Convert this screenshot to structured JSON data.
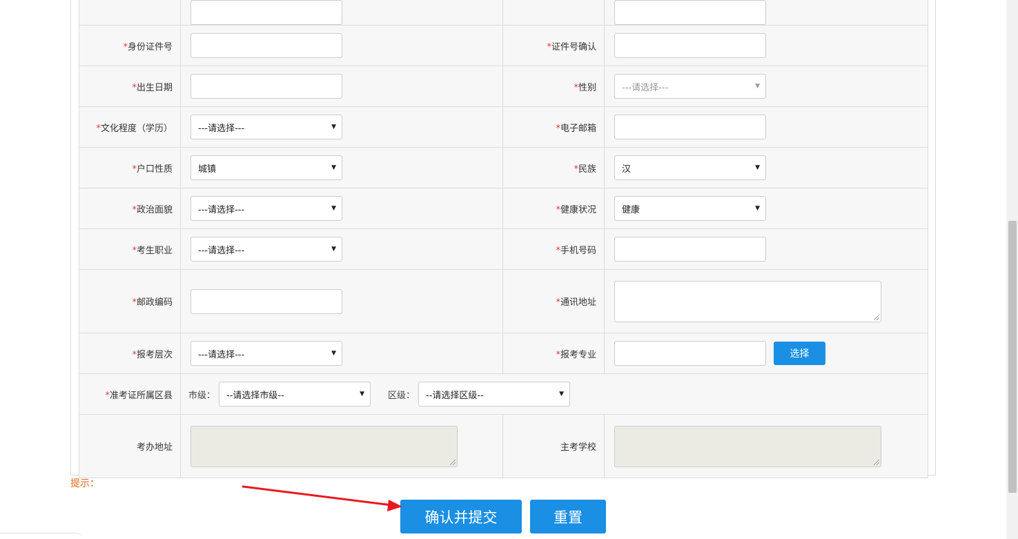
{
  "form": {
    "rows": [
      {
        "left": {
          "label": "身份证件号",
          "required": true,
          "type": "input",
          "value": ""
        },
        "right": {
          "label": "证件号确认",
          "required": true,
          "type": "input",
          "value": ""
        }
      },
      {
        "left": {
          "label": "出生日期",
          "required": true,
          "type": "input",
          "value": ""
        },
        "right": {
          "label": "性别",
          "required": true,
          "type": "select",
          "value": "---请选择---",
          "disabled": true
        }
      },
      {
        "left": {
          "label": "文化程度（学历）",
          "required": true,
          "type": "select",
          "value": "---请选择---"
        },
        "right": {
          "label": "电子邮箱",
          "required": true,
          "type": "input",
          "value": ""
        }
      },
      {
        "left": {
          "label": "户口性质",
          "required": true,
          "type": "select",
          "value": "城镇"
        },
        "right": {
          "label": "民族",
          "required": true,
          "type": "select",
          "value": "汉"
        }
      },
      {
        "left": {
          "label": "政治面貌",
          "required": true,
          "type": "select",
          "value": "---请选择---"
        },
        "right": {
          "label": "健康状况",
          "required": true,
          "type": "select",
          "value": "健康"
        }
      },
      {
        "left": {
          "label": "考生职业",
          "required": true,
          "type": "select",
          "value": "---请选择---"
        },
        "right": {
          "label": "手机号码",
          "required": true,
          "type": "input",
          "value": ""
        }
      },
      {
        "left": {
          "label": "邮政编码",
          "required": true,
          "type": "input",
          "value": ""
        },
        "right": {
          "label": "通讯地址",
          "required": true,
          "type": "textarea",
          "value": ""
        }
      },
      {
        "left": {
          "label": "报考层次",
          "required": true,
          "type": "select",
          "value": "---请选择---"
        },
        "right": {
          "label": "报考专业",
          "required": true,
          "type": "input",
          "value": "",
          "button": "选择"
        }
      }
    ],
    "region_row": {
      "label": "准考证所属区县",
      "required": true,
      "city_label": "市级：",
      "city_value": "--请选择市级--",
      "district_label": "区级：",
      "district_value": "--请选择区级--"
    },
    "office_row": {
      "left_label": "考办地址",
      "right_label": "主考学校"
    }
  },
  "hint": "提示：",
  "buttons": {
    "submit": "确认并提交",
    "reset": "重置"
  },
  "colors": {
    "primary": "#1a8fe3",
    "required_star": "#e4393c",
    "hint": "#e8651a",
    "annotation_arrow": "#e8191e"
  },
  "icons": {
    "select_arrow": "▼"
  }
}
